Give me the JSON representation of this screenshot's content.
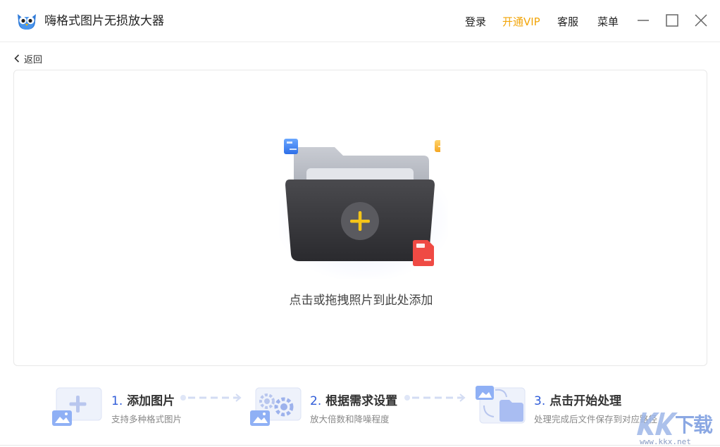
{
  "app": {
    "title": "嗨格式图片无损放大器"
  },
  "nav": {
    "login": "登录",
    "vip": "开通VIP",
    "service": "客服",
    "menu": "菜单"
  },
  "back": {
    "label": "返回"
  },
  "dropzone": {
    "hint": "点击或拖拽照片到此处添加"
  },
  "steps": [
    {
      "num": "1.",
      "title": "添加图片",
      "desc": "支持多种格式图片"
    },
    {
      "num": "2.",
      "title": "根据需求设置",
      "desc": "放大倍数和降噪程度"
    },
    {
      "num": "3.",
      "title": "点击开始处理",
      "desc": "处理完成后文件保存到对应路径"
    }
  ],
  "watermark": {
    "text": "下载",
    "url": "www.kkx.net"
  },
  "colors": {
    "accent_blue": "#2e5bd8",
    "vip_orange": "#f2a50a",
    "plus_yellow": "#f5c518"
  }
}
